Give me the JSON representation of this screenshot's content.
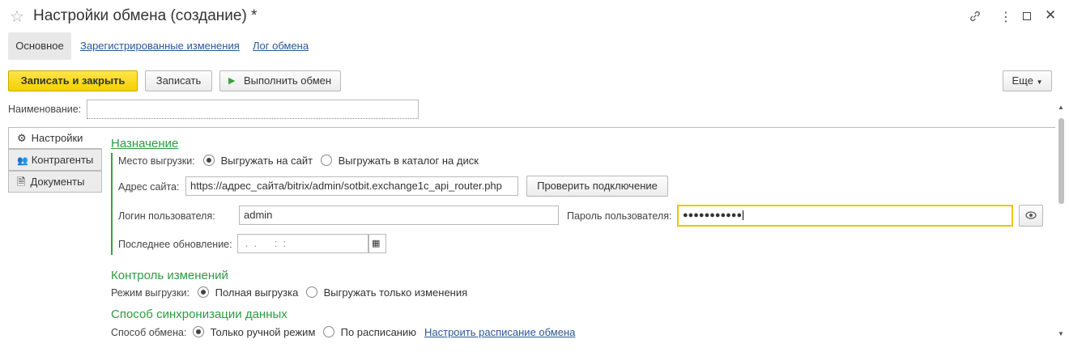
{
  "window": {
    "title": "Настройки обмена (создание) *",
    "star_icon": "star-icon",
    "link_icon": "link-icon",
    "more_icon": "more-vertical-icon",
    "maximize_icon": "maximize-icon",
    "close_icon": "close-icon"
  },
  "tabs": [
    {
      "label": "Основное"
    },
    {
      "label": "Зарегистрированные изменения"
    },
    {
      "label": "Лог обмена"
    }
  ],
  "toolbar": {
    "save_close": "Записать и закрыть",
    "save": "Записать",
    "run": "Выполнить обмен",
    "more": "Еще"
  },
  "name_field": {
    "label": "Наименование:",
    "value": ""
  },
  "side_tabs": [
    {
      "label": "Настройки",
      "icon": "gear-icon"
    },
    {
      "label": "Контрагенты",
      "icon": "users-icon"
    },
    {
      "label": "Документы",
      "icon": "document-icon"
    }
  ],
  "destination": {
    "title": "Назначение",
    "place_label": "Место выгрузки:",
    "opt_site": "Выгружать на сайт",
    "opt_disk": "Выгружать в каталог на диск",
    "address_label": "Адрес сайта:",
    "address_value": "https://адрес_сайта/bitrix/admin/sotbit.exchange1c_api_router.php",
    "check_button": "Проверить подключение",
    "login_label": "Логин пользователя:",
    "login_value": "admin",
    "password_label": "Пароль пользователя:",
    "password_value": "●●●●●●●●●●●",
    "last_update_label": "Последнее обновление:",
    "last_update_value": " .  .      :  :"
  },
  "change_control": {
    "title": "Контроль изменений",
    "mode_label": "Режим выгрузки:",
    "opt_full": "Полная выгрузка",
    "opt_changes": "Выгружать только изменения"
  },
  "sync": {
    "title": "Способ синхронизации данных",
    "method_label": "Способ обмена:",
    "opt_manual": "Только ручной режим",
    "opt_schedule": "По расписанию",
    "schedule_link": "Настроить расписание обмена"
  }
}
